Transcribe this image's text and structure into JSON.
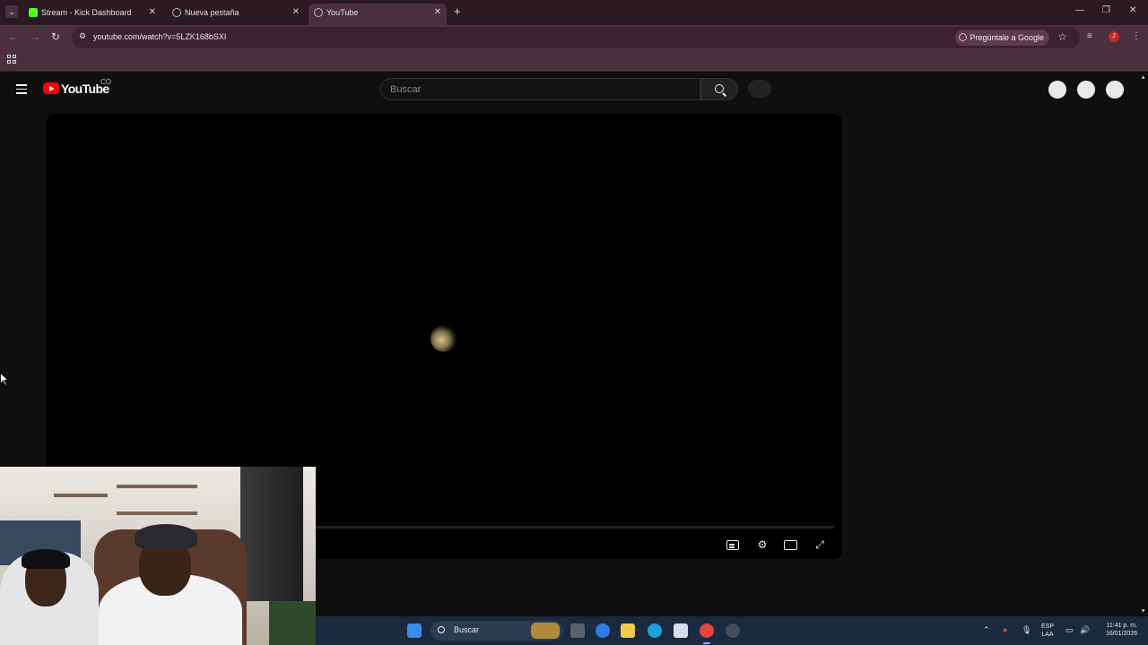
{
  "browser": {
    "tabs": [
      {
        "title": "Stream - Kick Dashboard",
        "favicon": "kick-icon",
        "color": "#53fc18"
      },
      {
        "title": "Nueva pestaña",
        "favicon": "chrome-icon",
        "color": "#bbbbbb"
      },
      {
        "title": "YouTube",
        "favicon": "youtube-icon",
        "color": "#bbbbbb",
        "active": true
      }
    ],
    "url": "youtube.com/watch?v=5LZK168bSXI",
    "ask_google": "Pregúntale a Google",
    "profile_initial": "J"
  },
  "youtube": {
    "logo_text": "YouTube",
    "logo_sup": "CO",
    "search_placeholder": "Buscar"
  },
  "taskbar": {
    "search_label": "Buscar",
    "lang_top": "ESP",
    "lang_bottom": "LAA",
    "time": "11:41 p. m.",
    "date": "16/01/2026"
  },
  "colors": {
    "chrome_frame": "#2b1a22",
    "chrome_toolbar": "#4b2f3d",
    "youtube_bg": "#0f0f0f",
    "youtube_red": "#ff0000",
    "taskbar": "#1b2a3e"
  }
}
